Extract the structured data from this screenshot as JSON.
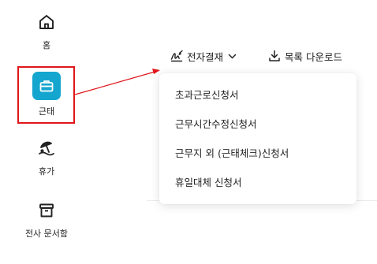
{
  "sidebar": {
    "home": {
      "label": "홈",
      "icon": "home-icon"
    },
    "attendance": {
      "label": "근태",
      "icon": "briefcase-icon",
      "accent": "#14a6cf",
      "selected": true
    },
    "vacation": {
      "label": "휴가",
      "icon": "beach-umbrella-icon"
    },
    "archive": {
      "label": "전사 문서함",
      "icon": "archive-box-icon"
    }
  },
  "toolbar": {
    "approval_label": "전자결재",
    "approval_icon": "signature-icon",
    "download_label": "목록 다운로드",
    "download_icon": "download-icon"
  },
  "approval_menu": {
    "items": [
      "초과근로신청서",
      "근무시간수정신청서",
      "근무지 외 (근태체크)신청서",
      "휴일대체 신청서"
    ]
  },
  "colors": {
    "highlight": "#e0161b",
    "accent": "#14a6cf"
  }
}
